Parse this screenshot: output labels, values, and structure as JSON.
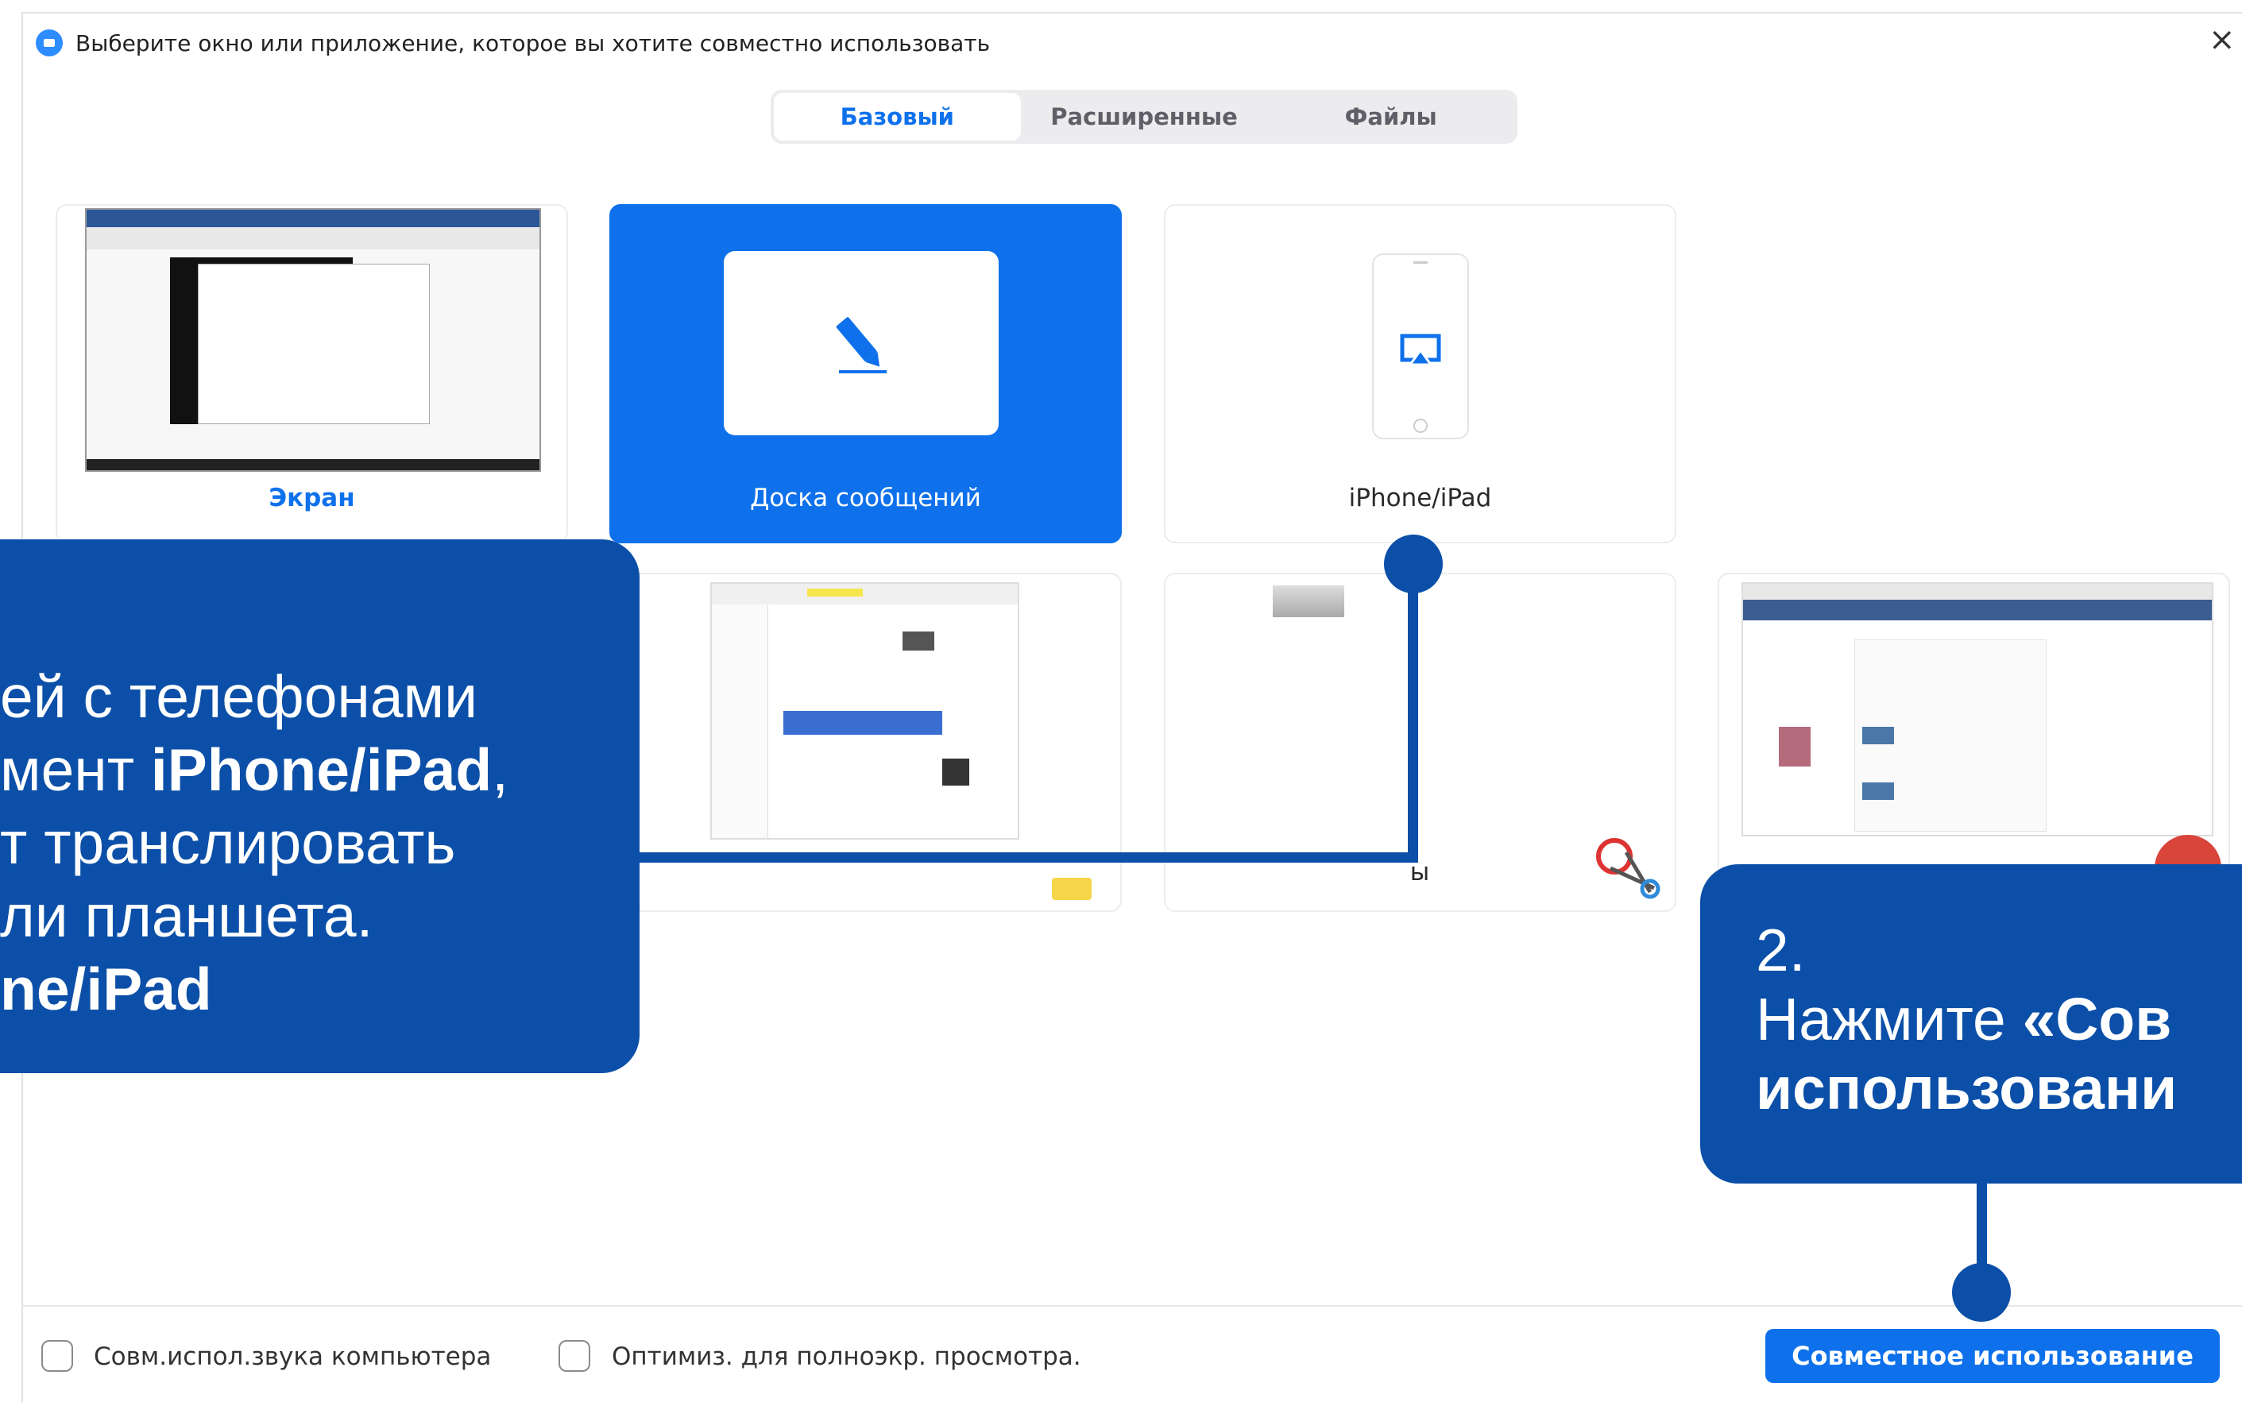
{
  "window": {
    "title": "Выберите окно или приложение, которое вы хотите совместно использовать",
    "close_icon": "×"
  },
  "tabs": [
    {
      "label": "Базовый",
      "active": true
    },
    {
      "label": "Расширенные",
      "active": false
    },
    {
      "label": "Файлы",
      "active": false
    }
  ],
  "tiles": {
    "screen": {
      "label": "Экран"
    },
    "whiteboard": {
      "label": "Доска сообщений"
    },
    "iphone": {
      "label": "iPhone/iPad"
    },
    "snip_partial": {
      "label": "ы"
    }
  },
  "options": {
    "computer_sound": "Совм.испол.звука компьютера",
    "fullscreen_optimize": "Оптимиз. для полноэкр. просмотра."
  },
  "share_button": {
    "label": "Совместное использование"
  },
  "callout1": {
    "line1": "ей с телефонами",
    "line2_prefix": "мент ",
    "line2_bold": "iPhone/iPad",
    "line2_suffix": ",",
    "line3": "т транслировать",
    "line4": "ли планшета.",
    "line5_bold": "ne/iPad"
  },
  "callout2": {
    "step": "2.",
    "line1_prefix": "Нажмите ",
    "line1_bold": "«Сов",
    "line2_bold": "использовани"
  },
  "colors": {
    "accent": "#0e71eb",
    "callout": "#0b4fa8"
  }
}
